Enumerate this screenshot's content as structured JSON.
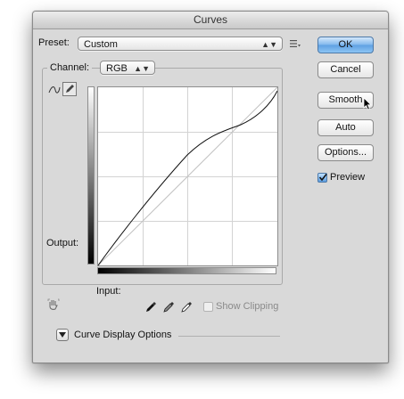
{
  "window": {
    "title": "Curves"
  },
  "preset": {
    "label": "Preset:",
    "value": "Custom"
  },
  "channel": {
    "label": "Channel:",
    "value": "RGB"
  },
  "graph": {
    "output_label": "Output:",
    "input_label": "Input:"
  },
  "buttons": {
    "ok": "OK",
    "cancel": "Cancel",
    "smooth": "Smooth",
    "auto": "Auto",
    "options": "Options..."
  },
  "preview": {
    "label": "Preview",
    "checked": true
  },
  "show_clipping": {
    "label": "Show Clipping",
    "checked": false
  },
  "curve_display_options": {
    "label": "Curve Display Options"
  },
  "icons": {
    "preset_menu": "preset-menu-icon",
    "curve_tool": "curve-point-tool-icon",
    "pencil_tool": "pencil-tool-icon",
    "hand_tool": "on-image-adjust-icon",
    "eyedroppers": [
      "black-point-eyedropper-icon",
      "gray-point-eyedropper-icon",
      "white-point-eyedropper-icon"
    ],
    "cursor": "mouse-cursor-icon"
  },
  "colors": {
    "accent": "#5ea0e2",
    "background": "#d9d9d9"
  }
}
